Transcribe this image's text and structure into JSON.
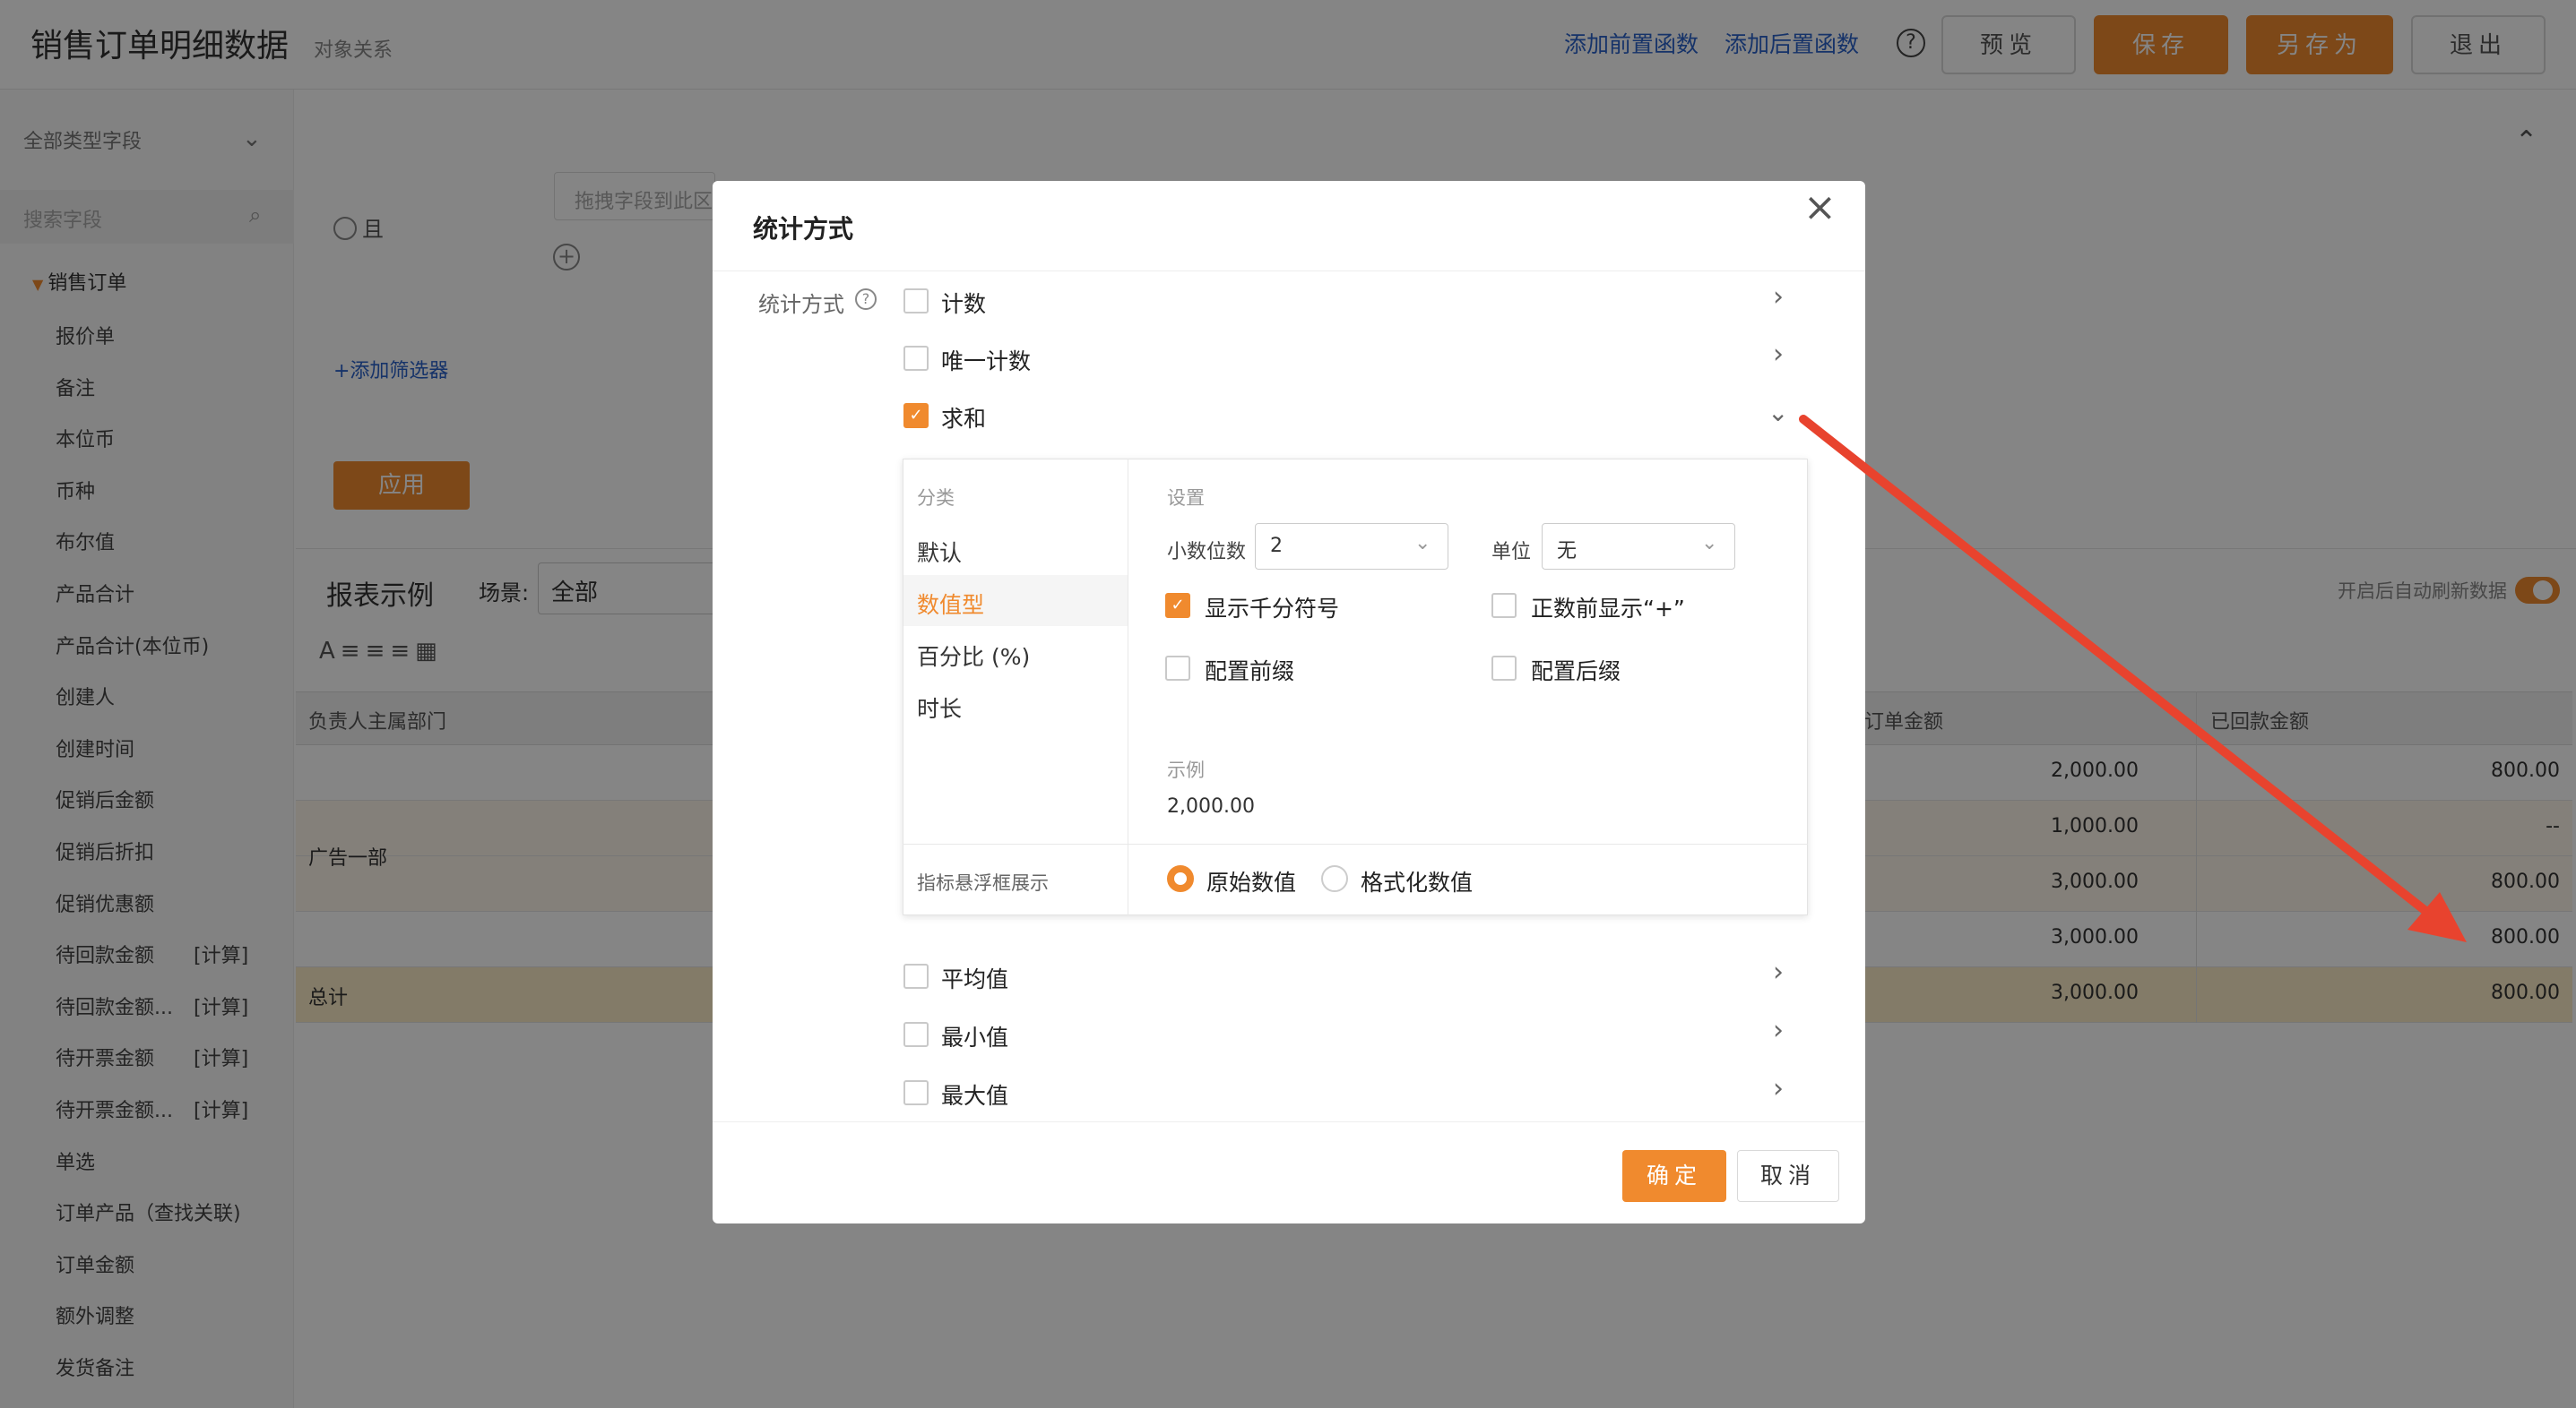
{
  "header": {
    "title": "销售订单明细数据",
    "subtitle": "对象关系",
    "add_pre_func": "添加前置函数",
    "add_post_func": "添加后置函数",
    "help": "?",
    "preview": "预览",
    "save": "保存",
    "save_as": "另存为",
    "exit": "退出"
  },
  "sidebar": {
    "field_type_select": "全部类型字段",
    "search_placeholder": "搜索字段",
    "root": "销售订单",
    "items": [
      {
        "label": "报价单",
        "tag": ""
      },
      {
        "label": "备注",
        "tag": ""
      },
      {
        "label": "本位币",
        "tag": ""
      },
      {
        "label": "币种",
        "tag": ""
      },
      {
        "label": "布尔值",
        "tag": ""
      },
      {
        "label": "产品合计",
        "tag": ""
      },
      {
        "label": "产品合计(本位币)",
        "tag": ""
      },
      {
        "label": "创建人",
        "tag": ""
      },
      {
        "label": "创建时间",
        "tag": ""
      },
      {
        "label": "促销后金额",
        "tag": ""
      },
      {
        "label": "促销后折扣",
        "tag": ""
      },
      {
        "label": "促销优惠额",
        "tag": ""
      },
      {
        "label": "待回款金额",
        "tag": "[计算]"
      },
      {
        "label": "待回款金额...",
        "tag": "[计算]"
      },
      {
        "label": "待开票金额",
        "tag": "[计算]"
      },
      {
        "label": "待开票金额...",
        "tag": "[计算]"
      },
      {
        "label": "单选",
        "tag": ""
      },
      {
        "label": "订单产品（查找关联)",
        "tag": ""
      },
      {
        "label": "订单金额",
        "tag": ""
      },
      {
        "label": "额外调整",
        "tag": ""
      },
      {
        "label": "发货备注",
        "tag": ""
      }
    ]
  },
  "filter": {
    "and_label": "且",
    "drag_placeholder": "拖拽字段到此区",
    "add_filter": "+添加筛选器",
    "apply": "应用"
  },
  "report": {
    "title": "报表示例",
    "scene_label": "场景:",
    "scene_value": "全部",
    "auto_refresh": "开启后自动刷新数据",
    "toolbar_glyphs": "A≡≡≡▦",
    "columns": [
      "负责人主属部门",
      "订单金额",
      "已回款金额"
    ],
    "group_label": "广告一部",
    "rows": [
      {
        "order": "2,000.00",
        "paid": "800.00"
      },
      {
        "order": "1,000.00",
        "paid": "--"
      },
      {
        "order": "3,000.00",
        "paid": "800.00"
      },
      {
        "order": "3,000.00",
        "paid": "800.00"
      }
    ],
    "total": {
      "label": "总计",
      "order": "3,000.00",
      "paid": "800.00"
    }
  },
  "modal": {
    "title": "统计方式",
    "field_label": "统计方式",
    "options_top": [
      {
        "label": "计数",
        "checked": false
      },
      {
        "label": "唯一计数",
        "checked": false
      },
      {
        "label": "求和",
        "checked": true
      }
    ],
    "panel": {
      "category_header": "分类",
      "categories": [
        "默认",
        "数值型",
        "百分比 (%)",
        "时长"
      ],
      "active_category": "数值型",
      "settings_header": "设置",
      "decimals_label": "小数位数",
      "decimals_value": "2",
      "unit_label": "单位",
      "unit_value": "无",
      "thousands_sep": "显示千分符号",
      "thousands_checked": true,
      "plus_sign": "正数前显示“+”",
      "prefix": "配置前缀",
      "suffix": "配置后缀",
      "example_header": "示例",
      "example_value": "2,000.00",
      "tooltip_label": "指标悬浮框展示",
      "radio_raw": "原始数值",
      "radio_formatted": "格式化数值",
      "radio_selected": "原始数值"
    },
    "options_bottom": [
      {
        "label": "平均值",
        "checked": false
      },
      {
        "label": "最小值",
        "checked": false
      },
      {
        "label": "最大值",
        "checked": false
      }
    ],
    "ok": "确定",
    "cancel": "取消"
  },
  "colors": {
    "accent": "#f08a2e",
    "link": "#2b62c9",
    "annotation_arrow": "#e8432e"
  }
}
